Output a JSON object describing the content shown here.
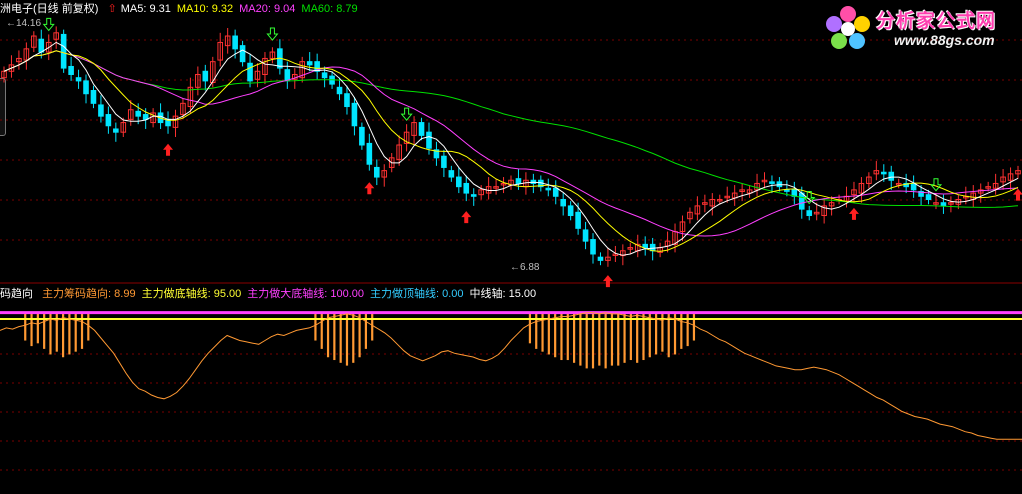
{
  "price_panel": {
    "title": "洲电子(日线 前复权)",
    "indicators": [
      {
        "label": "MA5: 9.31",
        "color": "#ffffff"
      },
      {
        "label": "MA10: 9.32",
        "color": "#ffff00"
      },
      {
        "label": "MA20: 9.04",
        "color": "#ff40ff"
      },
      {
        "label": "MA60: 8.79",
        "color": "#00e000"
      }
    ],
    "high_label": "14.16",
    "low_label": "6.88"
  },
  "indicator_panel": {
    "title": "码趋向",
    "items": [
      {
        "label": "主力筹码趋向: 8.99",
        "color": "#ff9933"
      },
      {
        "label": "主力做底轴线: 95.00",
        "color": "#ffff33"
      },
      {
        "label": "主力做大底轴线: 100.00",
        "color": "#ff40ff"
      },
      {
        "label": "主力做顶轴线: 0.00",
        "color": "#33ccff"
      },
      {
        "label": "中线轴: 15.00",
        "color": "#ffffff"
      }
    ]
  },
  "watermark": {
    "brand": "分析家公式网",
    "url": "www.88gs.com"
  },
  "colors": {
    "up": "#ff3232",
    "down": "#00e5ff",
    "grid": "#7a0000",
    "ma5": "#ffffff",
    "ma10": "#ffff00",
    "ma20": "#ff40ff",
    "ma60": "#00e000",
    "trend": "#ff9933",
    "axis_bottom": "#ffff33",
    "axis_top": "#ff40ff"
  },
  "chart_data": {
    "type": "candlestick",
    "price_range": [
      6.88,
      14.16
    ],
    "close": [
      12.9,
      13.1,
      13.3,
      13.6,
      14.0,
      13.5,
      13.8,
      14.1,
      13.0,
      12.8,
      12.6,
      12.2,
      11.9,
      11.5,
      11.2,
      11.0,
      11.3,
      11.7,
      11.5,
      11.4,
      11.6,
      11.3,
      11.2,
      11.5,
      11.9,
      12.4,
      12.8,
      12.6,
      13.2,
      13.8,
      14.0,
      13.6,
      13.2,
      12.6,
      12.9,
      13.3,
      13.5,
      13.0,
      12.6,
      12.8,
      13.2,
      13.1,
      12.9,
      12.7,
      12.5,
      12.2,
      11.8,
      11.2,
      10.6,
      10.0,
      9.6,
      9.8,
      10.2,
      10.6,
      11.0,
      11.3,
      10.9,
      10.5,
      10.2,
      9.9,
      9.6,
      9.3,
      9.1,
      9.0,
      9.2,
      9.3,
      9.3,
      9.4,
      9.5,
      9.4,
      9.5,
      9.4,
      9.3,
      9.2,
      9.0,
      8.7,
      8.4,
      8.0,
      7.6,
      7.2,
      7.0,
      7.1,
      7.2,
      7.3,
      7.4,
      7.5,
      7.4,
      7.3,
      7.4,
      7.6,
      7.9,
      8.2,
      8.5,
      8.7,
      8.8,
      8.9,
      8.9,
      9.0,
      9.1,
      9.2,
      9.2,
      9.4,
      9.5,
      9.4,
      9.3,
      9.2,
      9.0,
      8.6,
      8.4,
      8.5,
      8.7,
      8.8,
      8.9,
      9.0,
      9.2,
      9.4,
      9.6,
      9.8,
      9.7,
      9.5,
      9.4,
      9.3,
      9.2,
      9.0,
      8.9,
      8.8,
      8.7,
      8.8,
      8.9,
      9.0,
      9.1,
      9.2,
      9.3,
      9.4,
      9.6,
      9.7,
      9.8
    ],
    "trend": [
      86,
      88,
      87,
      89,
      90,
      92,
      91,
      93,
      95,
      94,
      96,
      95,
      94,
      93,
      90,
      86,
      80,
      74,
      68,
      60,
      52,
      45,
      40,
      38,
      35,
      33,
      32,
      34,
      37,
      42,
      48,
      55,
      62,
      68,
      73,
      78,
      82,
      80,
      78,
      77,
      76,
      75,
      78,
      81,
      83,
      82,
      84,
      86,
      87,
      88,
      90,
      93,
      96,
      97,
      98,
      99,
      98,
      96,
      93,
      90,
      87,
      84,
      80,
      75,
      70,
      66,
      64,
      62,
      64,
      66,
      69,
      70,
      68,
      67,
      66,
      65,
      63,
      62,
      64,
      67,
      72,
      78,
      83,
      88,
      91,
      93,
      94,
      95,
      96,
      97,
      97,
      98,
      99,
      100,
      100,
      99,
      100,
      99,
      99,
      98,
      97,
      98,
      97,
      96,
      95,
      94,
      96,
      95,
      93,
      92,
      90,
      87,
      85,
      82,
      79,
      77,
      74,
      71,
      68,
      66,
      64,
      62,
      60,
      58,
      57,
      56,
      55,
      55,
      56,
      57,
      56,
      55,
      53,
      51,
      48,
      45,
      42,
      39,
      36,
      33,
      31,
      28,
      25,
      22,
      20,
      18,
      17,
      16,
      14,
      12,
      11,
      10,
      8,
      6,
      5,
      3,
      2,
      1,
      0,
      0,
      0,
      0,
      0
    ]
  }
}
